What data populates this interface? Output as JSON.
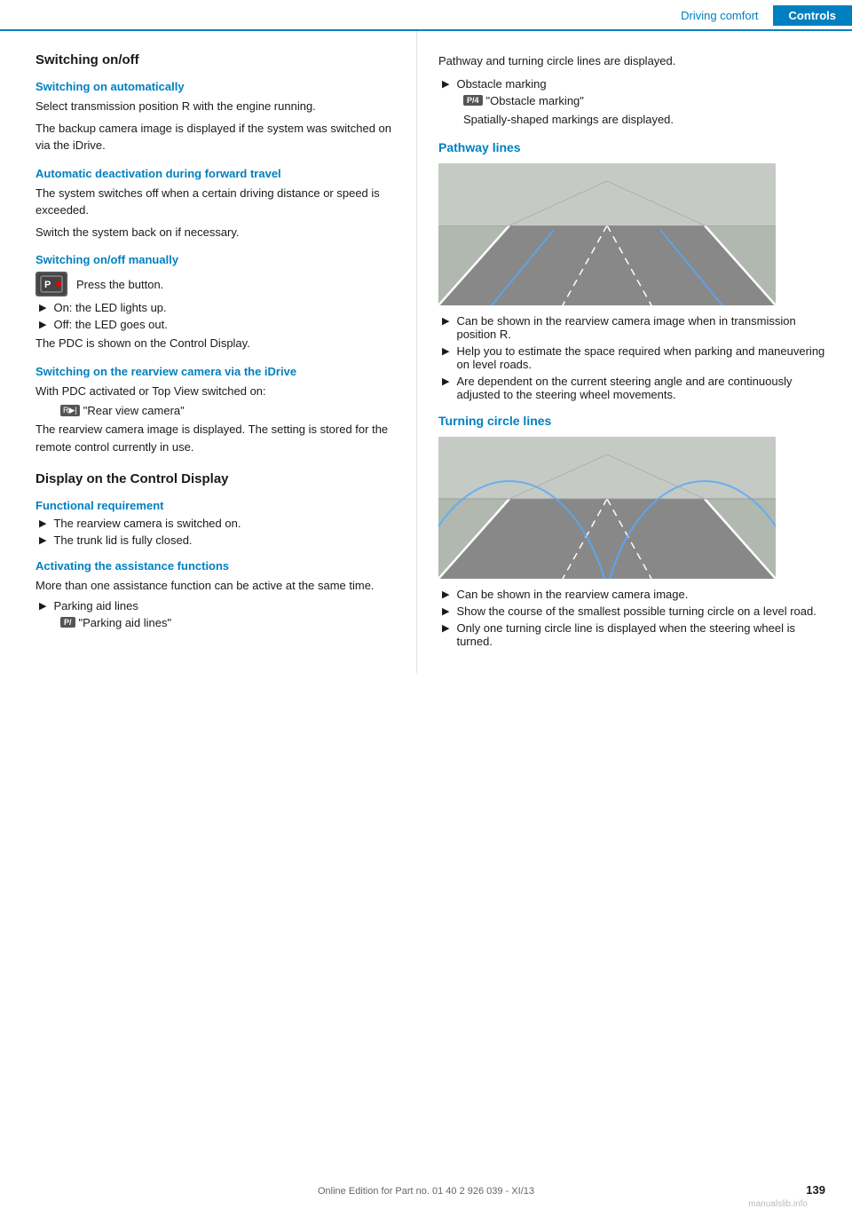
{
  "header": {
    "driving_comfort": "Driving comfort",
    "controls": "Controls"
  },
  "left": {
    "main_title": "Switching on/off",
    "sections": [
      {
        "id": "switching-auto",
        "title": "Switching on automatically",
        "paragraphs": [
          "Select transmission position R with the engine running.",
          "The backup camera image is displayed if the system was switched on via the iDrive."
        ]
      },
      {
        "id": "auto-deactivation",
        "title": "Automatic deactivation during forward travel",
        "paragraphs": [
          "The system switches off when a certain driving distance or speed is exceeded.",
          "Switch the system back on if necessary."
        ]
      },
      {
        "id": "switching-manual",
        "title": "Switching on/off manually",
        "button_label": "Press the button.",
        "items": [
          "On: the LED lights up.",
          "Off: the LED goes out."
        ],
        "pdc_text": "The PDC is shown on the Control Display."
      },
      {
        "id": "switching-rearview",
        "title": "Switching on the rearview camera via the iDrive",
        "paragraphs": [
          "With PDC activated or Top View switched on:",
          "\"Rear view camera\"",
          "The rearview camera image is displayed. The setting is stored for the remote control currently in use."
        ]
      },
      {
        "id": "display-control",
        "title": "Display on the Control Display",
        "is_bold": true
      },
      {
        "id": "functional-req",
        "title": "Functional requirement",
        "items": [
          "The rearview camera is switched on.",
          "The trunk lid is fully closed."
        ]
      },
      {
        "id": "activating-assist",
        "title": "Activating the assistance functions",
        "paragraphs": [
          "More than one assistance function can be active at the same time."
        ],
        "sub_items": [
          {
            "label": "Parking aid lines",
            "icon": "P/",
            "icon_text": "\"Parking aid lines\""
          }
        ]
      }
    ]
  },
  "right": {
    "sections": [
      {
        "id": "pathway-intro",
        "paragraphs": [
          "Pathway and turning circle lines are displayed."
        ],
        "items": [
          {
            "label": "Obstacle marking",
            "icon": "P/4",
            "icon_text": "\"Obstacle marking\"",
            "sub_text": "Spatially-shaped markings are displayed."
          }
        ]
      },
      {
        "id": "pathway-lines",
        "title": "Pathway lines",
        "image_alt": "Pathway lines camera view",
        "items": [
          "Can be shown in the rearview camera image when in transmission position R.",
          "Help you to estimate the space required when parking and maneuvering on level roads.",
          "Are dependent on the current steering angle and are continuously adjusted to the steering wheel movements."
        ]
      },
      {
        "id": "turning-circle",
        "title": "Turning circle lines",
        "image_alt": "Turning circle lines camera view",
        "items": [
          "Can be shown in the rearview camera image.",
          "Show the course of the smallest possible turning circle on a level road.",
          "Only one turning circle line is displayed when the steering wheel is turned."
        ]
      }
    ]
  },
  "footer": {
    "text": "Online Edition for Part no. 01 40 2 926 039 - XI/13",
    "page": "139",
    "watermark": "manualslib.info"
  }
}
